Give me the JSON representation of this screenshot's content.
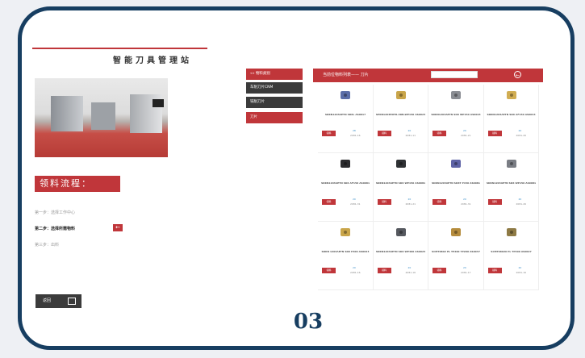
{
  "station_title": "智能刀具管理站",
  "flow": {
    "title": "领料流程：",
    "steps": [
      {
        "label": "第一步：选择工作中心",
        "active": false
      },
      {
        "label": "第二步：选择所需物料",
        "active": true
      },
      {
        "label": "第三步：出料",
        "active": false
      }
    ],
    "current_arrow": "←"
  },
  "confirm_button": "返回",
  "menu": [
    {
      "label": "«« 物料类别",
      "style": "red"
    },
    {
      "label": "车削刀片CNM",
      "style": "dark"
    },
    {
      "label": "铣削刀片",
      "style": "dark"
    },
    {
      "label": "刀片",
      "style": "red"
    }
  ],
  "products_panel": {
    "title": "当前位物料列表—— 刀片",
    "prev_icon": "arrow-left-icon",
    "next_icon": "arrow-right-icon"
  },
  "get_button_label": "领料",
  "products": [
    {
      "code": "SDKN1203AETN SD6L AS0017",
      "num": "28",
      "info": "2081-16",
      "color": "#5b6ea8"
    },
    {
      "code": "SPKN1203EDTR-3DB-WP150 AS0023",
      "num": "20",
      "info": "2081-11",
      "color": "#c9a54a"
    },
    {
      "code": "SDKN1203AETN SD6 WP150 AS0023",
      "num": "20",
      "info": "2081-21",
      "color": "#8a8d93"
    },
    {
      "code": "SDKN1203AETN SD6 AF150 AS0044",
      "num": "20",
      "info": "2081-26",
      "color": "#d1ad52"
    },
    {
      "code": "SDKN1203AETN SD6 AF150 AS0081",
      "num": "20",
      "info": "2081-31",
      "color": "#2b2b2e"
    },
    {
      "code": "SDKN1203AETN SD6 WP150 AS0081",
      "num": "20",
      "info": "2081-21",
      "color": "#2f3134"
    },
    {
      "code": "SDKN1203AETN SD6T P150 AS0081",
      "num": "20",
      "info": "2081-31",
      "color": "#5e63a6"
    },
    {
      "code": "SDKN1203AETN SD6 WP150 AS0081",
      "num": "20",
      "info": "2081-26",
      "color": "#7a7d84"
    },
    {
      "code": "SDKN 1203AETN SD6 P400 AS0023",
      "num": "20",
      "info": "2081-16",
      "color": "#c9a54a"
    },
    {
      "code": "SDKN1203AETN SD6 WP400 AS0023",
      "num": "20",
      "info": "2081-16",
      "color": "#55585e"
    },
    {
      "code": "SCMT0802 PL TP200 TP200 AS0037",
      "num": "20",
      "info": "2081-17",
      "color": "#b58c3d"
    },
    {
      "code": "SCMT08020 PL TP400 AS0027",
      "num": "20",
      "info": "2081-16",
      "color": "#8e7a45"
    }
  ],
  "page_number": "03"
}
